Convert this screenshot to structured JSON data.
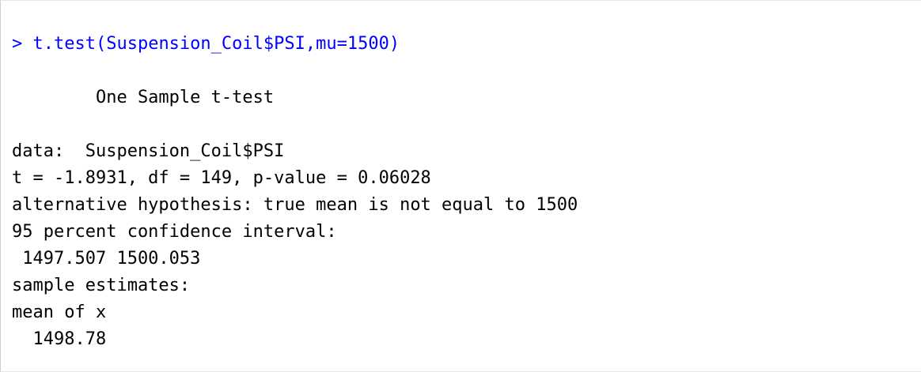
{
  "console": {
    "prompt": "> ",
    "command": "t.test(Suspension_Coil$PSI,mu=1500)",
    "output": {
      "title": "        One Sample t-test",
      "data_line": "data:  Suspension_Coil$PSI",
      "stat_line": "t = -1.8931, df = 149, p-value = 0.06028",
      "alternative_line": "alternative hypothesis: true mean is not equal to 1500",
      "ci_header": "95 percent confidence interval:",
      "ci_values": " 1497.507 1500.053",
      "estimates_header": "sample estimates:",
      "estimate_label": "mean of x ",
      "estimate_value": "  1498.78"
    }
  },
  "colors": {
    "command": "#0000ff",
    "output": "#000000",
    "background": "#ffffff"
  }
}
